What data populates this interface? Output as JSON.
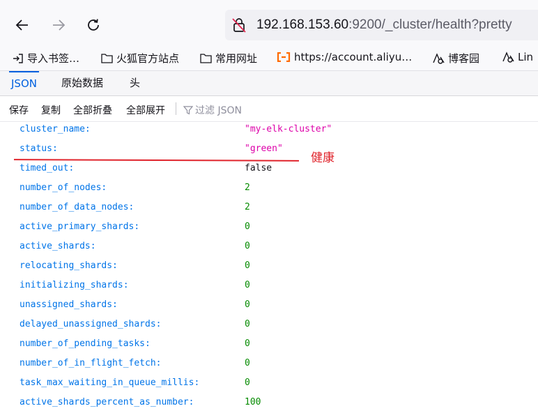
{
  "navbar": {
    "url_host": "192.168.153.60",
    "url_rest": ":9200/_cluster/health?pretty",
    "icons": [
      "back-arrow-icon",
      "forward-arrow-icon",
      "reload-icon",
      "insecure-lock-icon"
    ]
  },
  "bookmarks": [
    {
      "label": "导入书签…",
      "icon": "import-icon"
    },
    {
      "label": "火狐官方站点",
      "icon": "folder-icon"
    },
    {
      "label": "常用网址",
      "icon": "folder-icon"
    },
    {
      "label": "https://account.aliyu…",
      "icon": "aliyun-icon"
    },
    {
      "label": "博客园",
      "icon": "blog-icon"
    },
    {
      "label": "Lin",
      "icon": "blog-icon"
    }
  ],
  "viewer": {
    "tabs": [
      "JSON",
      "原始数据",
      "头"
    ],
    "active_tab": "JSON",
    "toolbar": {
      "save": "保存",
      "copy": "复制",
      "collapse_all": "全部折叠",
      "expand_all": "全部展开",
      "filter": "过滤 JSON"
    }
  },
  "rows": [
    {
      "key": "cluster_name:",
      "value": "\"my-elk-cluster\"",
      "type": "string"
    },
    {
      "key": "status:",
      "value": "\"green\"",
      "type": "string"
    },
    {
      "key": "timed_out:",
      "value": "false",
      "type": "bool"
    },
    {
      "key": "number_of_nodes:",
      "value": "2",
      "type": "number"
    },
    {
      "key": "number_of_data_nodes:",
      "value": "2",
      "type": "number"
    },
    {
      "key": "active_primary_shards:",
      "value": "0",
      "type": "number"
    },
    {
      "key": "active_shards:",
      "value": "0",
      "type": "number"
    },
    {
      "key": "relocating_shards:",
      "value": "0",
      "type": "number"
    },
    {
      "key": "initializing_shards:",
      "value": "0",
      "type": "number"
    },
    {
      "key": "unassigned_shards:",
      "value": "0",
      "type": "number"
    },
    {
      "key": "delayed_unassigned_shards:",
      "value": "0",
      "type": "number"
    },
    {
      "key": "number_of_pending_tasks:",
      "value": "0",
      "type": "number"
    },
    {
      "key": "number_of_in_flight_fetch:",
      "value": "0",
      "type": "number"
    },
    {
      "key": "task_max_waiting_in_queue_millis:",
      "value": "0",
      "type": "number"
    },
    {
      "key": "active_shards_percent_as_number:",
      "value": "100",
      "type": "number"
    }
  ],
  "annotation": {
    "text": "健康",
    "color": "#e0242c"
  },
  "colors": {
    "key": "#0074e8",
    "string": "#dd00a9",
    "number": "#058b00",
    "accent": "#0060df"
  }
}
